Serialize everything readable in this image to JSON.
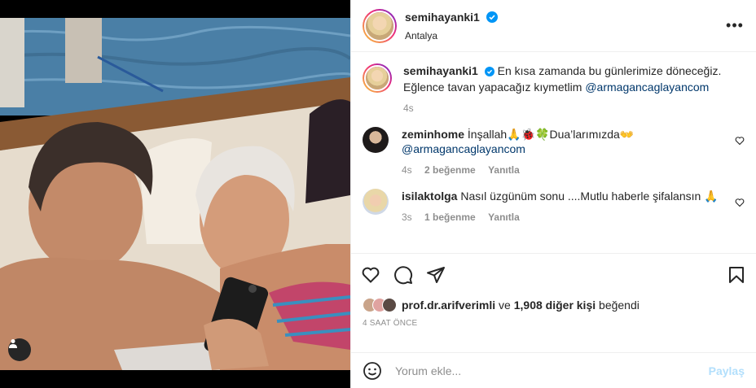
{
  "post": {
    "username": "semihayanki1",
    "location": "Antalya",
    "more_label": "•••"
  },
  "caption": {
    "username": "semihayanki1",
    "text": "En kısa zamanda bu günlerimize döneceğiz. Eğlence tavan yapacağız kıymetlim ",
    "mention": "@armagancaglayancom",
    "time": "4s"
  },
  "comments": [
    {
      "username": "zeminhome",
      "text": "İnşallah🙏🐞🍀Dua’larımızda👐",
      "mention": "@armagancaglayancom",
      "time": "4s",
      "likes": "2 beğenme",
      "reply": "Yanıtla"
    },
    {
      "username": "isilaktolga",
      "text": "Nasıl üzgünüm sonu ....Mutlu haberle şifalansın 🙏",
      "time": "3s",
      "likes": "1 beğenme",
      "reply": "Yanıtla"
    }
  ],
  "likes": {
    "first_user": "prof.dr.arifverimli",
    "connector": " ve ",
    "others": "1,908 diğer kişi",
    "suffix": " beğendi"
  },
  "timestamp": "4 SAAT ÖNCE",
  "add_comment": {
    "placeholder": "Yorum ekle...",
    "post_label": "Paylaş"
  },
  "icons": {
    "verified": "verified-badge-icon",
    "heart": "heart-icon",
    "comment": "comment-icon",
    "share": "share-icon",
    "save": "bookmark-icon",
    "emoji": "emoji-icon",
    "user_tag": "user-tag-icon"
  },
  "colors": {
    "verified_blue": "#0095f6",
    "mention": "#00376b",
    "post_button_disabled": "#b2dffc"
  }
}
